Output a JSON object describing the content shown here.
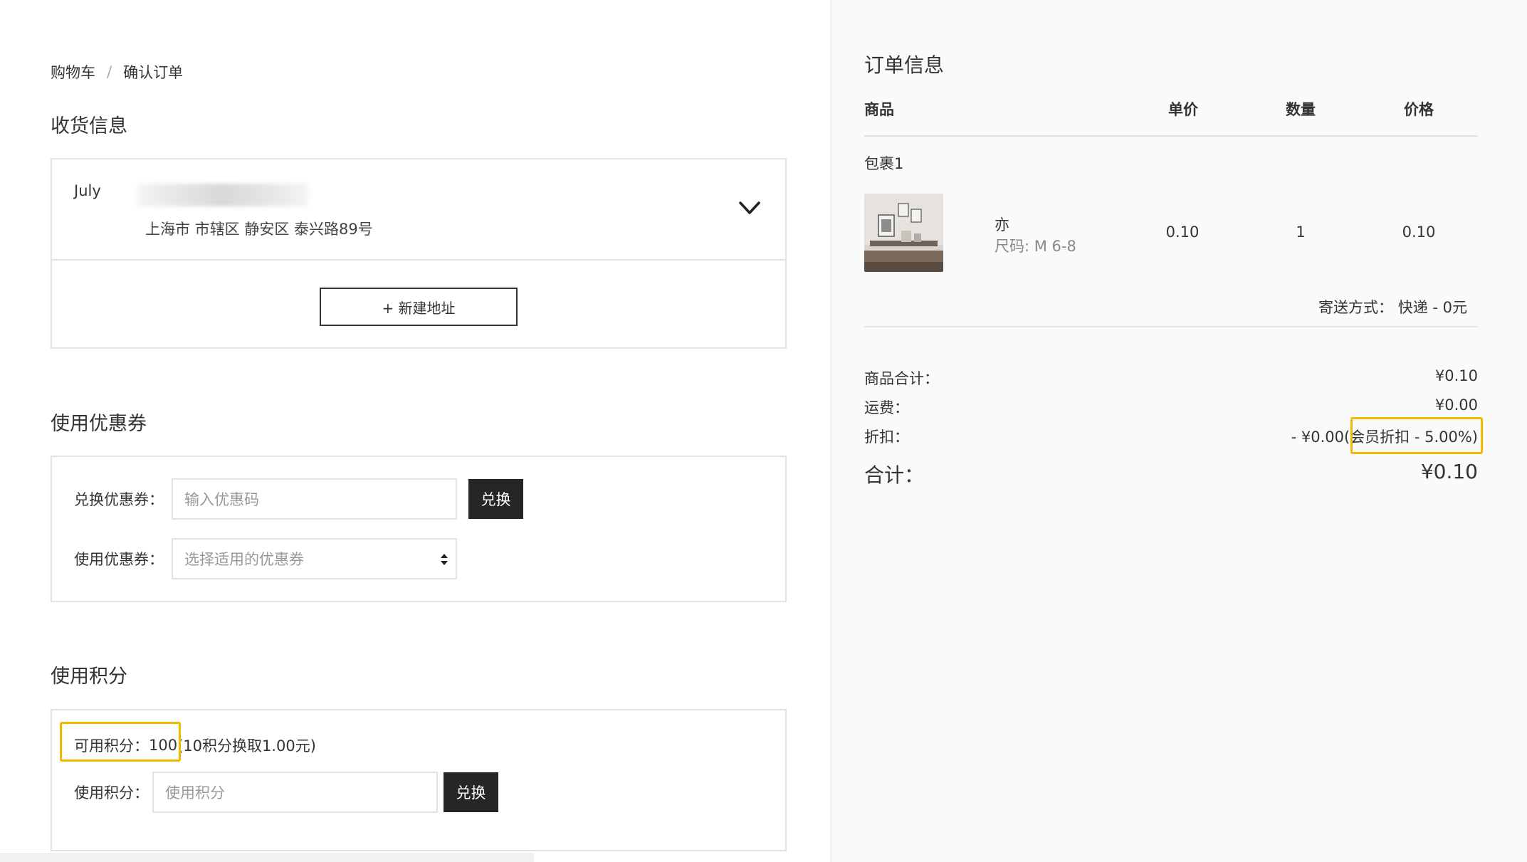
{
  "breadcrumb": {
    "cart": "购物车",
    "separator": "/",
    "confirm": "确认订单"
  },
  "shipping": {
    "title": "收货信息",
    "name": "July",
    "address": "上海市 市辖区 静安区 泰兴路89号",
    "new_address_label": "+ 新建地址"
  },
  "coupon": {
    "title": "使用优惠券",
    "redeem_label": "兑换优惠券：",
    "redeem_placeholder": "输入优惠码",
    "redeem_button": "兑换",
    "use_label": "使用优惠券：",
    "select_placeholder": "选择适用的优惠券"
  },
  "points": {
    "title": "使用积分",
    "available_label": "可用积分：",
    "available_value": "100",
    "rate_text": "(10积分换取1.00元)",
    "use_label": "使用积分：",
    "use_placeholder": "使用积分",
    "redeem_button": "兑换"
  },
  "order": {
    "title": "订单信息",
    "columns": {
      "product": "商品",
      "unit_price": "单价",
      "quantity": "数量",
      "price": "价格"
    },
    "package_label": "包裹1",
    "item": {
      "name": "亦",
      "size": "尺码: M 6-8",
      "unit_price": "0.10",
      "quantity": "1",
      "price": "0.10"
    },
    "shipping_method": "寄送方式： 快递 - 0元",
    "summary": {
      "subtotal_label": "商品合计：",
      "subtotal_value": "¥0.10",
      "freight_label": "运费：",
      "freight_value": "¥0.00",
      "discount_label": "折扣：",
      "discount_value": "- ¥0.00",
      "discount_note": "(会员折扣 - 5.00%)",
      "total_label": "合计：",
      "total_value": "¥0.10"
    }
  },
  "colors": {
    "highlight": "#f5b800",
    "dark_button": "#262626"
  }
}
